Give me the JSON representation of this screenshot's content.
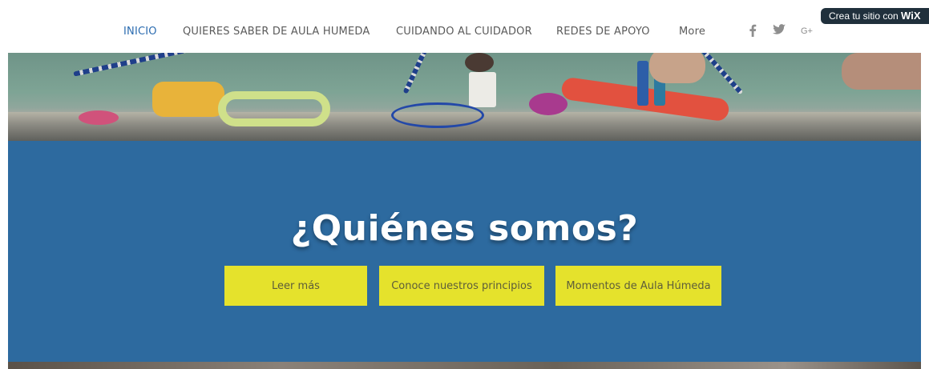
{
  "nav": {
    "items": [
      {
        "label": "INICIO",
        "active": true
      },
      {
        "label": "QUIERES SABER DE AULA HUMEDA",
        "active": false
      },
      {
        "label": "CUIDANDO AL CUIDADOR",
        "active": false
      },
      {
        "label": "REDES DE APOYO",
        "active": false
      },
      {
        "label": "More",
        "active": false
      }
    ],
    "social": [
      "facebook-icon",
      "twitter-icon",
      "google-plus-icon"
    ],
    "active_color": "#2b6cb0"
  },
  "wix_banner": {
    "text": "Crea tu sitio con ",
    "brand": "WiX"
  },
  "hero": {
    "title": "¿Quiénes somos?",
    "background": "#2d6a9f",
    "buttons": [
      "Leer más",
      "Conoce nuestros principios",
      "Momentos de Aula Húmeda"
    ],
    "button_color": "#e5e22c"
  }
}
